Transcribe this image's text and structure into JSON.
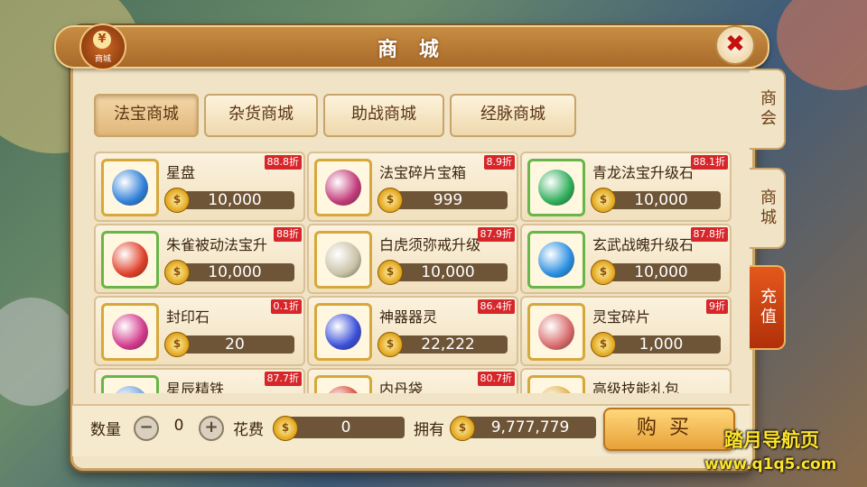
{
  "window": {
    "title": "商 城",
    "badge_label": "商城",
    "badge_glyph": "¥",
    "close_glyph": "✖"
  },
  "side_tabs": [
    {
      "label": "商会",
      "active": false
    },
    {
      "label": "商城",
      "active": false
    },
    {
      "label": "充值",
      "active": true
    }
  ],
  "category_tabs": [
    {
      "label": "法宝商城",
      "active": true
    },
    {
      "label": "杂货商城",
      "active": false
    },
    {
      "label": "助战商城",
      "active": false
    },
    {
      "label": "经脉商城",
      "active": false
    }
  ],
  "items": [
    {
      "name": "星盘",
      "discount": "88.8折",
      "price": "10,000",
      "frame": "gold",
      "gem_color": "#2f7fd8"
    },
    {
      "name": "法宝碎片宝箱",
      "discount": "8.9折",
      "price": "999",
      "frame": "gold",
      "gem_color": "#c23b7a"
    },
    {
      "name": "青龙法宝升级石",
      "discount": "88.1折",
      "price": "10,000",
      "frame": "green",
      "gem_color": "#2fae5a"
    },
    {
      "name": "朱雀被动法宝升",
      "discount": "88折",
      "price": "10,000",
      "frame": "green",
      "gem_color": "#e0402a"
    },
    {
      "name": "白虎须弥戒升级",
      "discount": "87.9折",
      "price": "10,000",
      "frame": "gold",
      "gem_color": "#c9c2a8"
    },
    {
      "name": "玄武战魄升级石",
      "discount": "87.8折",
      "price": "10,000",
      "frame": "green",
      "gem_color": "#2a8fe0"
    },
    {
      "name": "封印石",
      "discount": "0.1折",
      "price": "20",
      "frame": "gold",
      "gem_color": "#d23a8c"
    },
    {
      "name": "神器器灵",
      "discount": "86.4折",
      "price": "22,222",
      "frame": "gold",
      "gem_color": "#3a4fd8"
    },
    {
      "name": "灵宝碎片",
      "discount": "9折",
      "price": "1,000",
      "frame": "gold",
      "gem_color": "#d86a6a"
    },
    {
      "name": "星辰精铁",
      "discount": "87.7折",
      "price": "",
      "frame": "green",
      "gem_color": "#7aa6d8"
    },
    {
      "name": "内丹袋",
      "discount": "80.7折",
      "price": "",
      "frame": "gold",
      "gem_color": "#d84a3a"
    },
    {
      "name": "高级技能礼包",
      "discount": "",
      "price": "",
      "frame": "gold",
      "gem_color": "#e0b04a"
    }
  ],
  "coin_glyph": "$",
  "bottom": {
    "qty_label": "数量",
    "minus": "−",
    "qty_value": "0",
    "plus": "+",
    "cost_label": "花费",
    "cost_value": "0",
    "own_label": "拥有",
    "own_value": "9,777,779",
    "buy_label": "购买"
  },
  "watermark": {
    "line1": "踏月导航页",
    "line2": "www.q1q5.com"
  }
}
